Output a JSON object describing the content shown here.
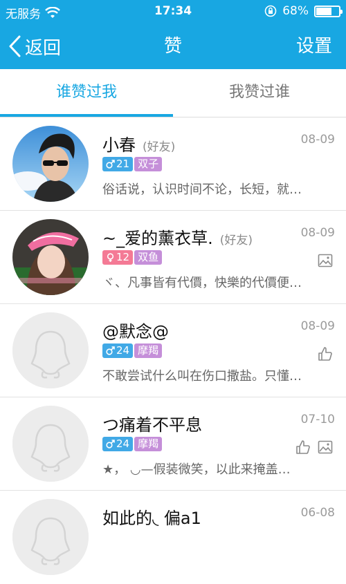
{
  "status": {
    "carrier": "无服务",
    "time": "17:34",
    "battery": "68%",
    "battery_level": 0.68
  },
  "nav": {
    "back": "返回",
    "title": "赞",
    "settings": "设置"
  },
  "tabs": [
    {
      "label": "谁赞过我",
      "active": true
    },
    {
      "label": "我赞过谁",
      "active": false
    }
  ],
  "list": [
    {
      "name": "小春",
      "tag": "(好友)",
      "date": "08-09",
      "gender": "male",
      "age": "21",
      "zodiac": "双子",
      "sign": "俗话说，认识时间不论，长短，就…",
      "icons": [],
      "avatar": "photo-boy"
    },
    {
      "name": "~_爱的薰衣草.",
      "tag": "(好友)",
      "date": "08-09",
      "gender": "female",
      "age": "12",
      "zodiac": "双鱼",
      "sign": "ヾ、凡事皆有代價，快樂的代價便…",
      "icons": [
        "image-icon"
      ],
      "avatar": "photo-girl"
    },
    {
      "name": "@默念@",
      "tag": "",
      "date": "08-09",
      "gender": "male",
      "age": "24",
      "zodiac": "摩羯",
      "sign": "不敢尝试什么叫在伤口撒盐。只懂…",
      "icons": [
        "thumbs-up-icon"
      ],
      "avatar": "default"
    },
    {
      "name": "つ痛着不平息",
      "tag": "",
      "date": "07-10",
      "gender": "male",
      "age": "24",
      "zodiac": "摩羯",
      "sign": "★，   ◡—假装微笑，以此来掩盖…",
      "icons": [
        "thumbs-up-icon",
        "image-icon"
      ],
      "avatar": "default"
    },
    {
      "name": "如此的◟ 偏a1",
      "tag": "",
      "date": "06-08",
      "gender": "",
      "age": "",
      "zodiac": "",
      "sign": "",
      "icons": [],
      "avatar": "default"
    }
  ],
  "colors": {
    "accent": "#18a7e2",
    "male_badge": "#41a9e6",
    "female_badge": "#f47a95",
    "zodiac_badge": "#c58fd9"
  }
}
